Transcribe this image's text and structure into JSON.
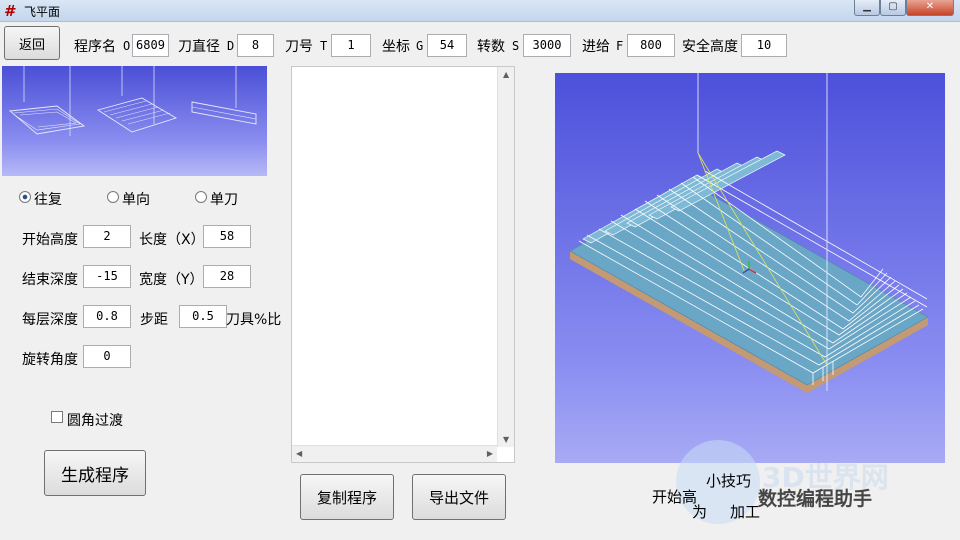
{
  "window": {
    "title": "飞平面",
    "icon_glyph": "#"
  },
  "toolbar": {
    "back_label": "返回",
    "params": [
      {
        "label": "程序名",
        "prefix": "O",
        "value": "6809"
      },
      {
        "label": "刀直径",
        "prefix": "D",
        "value": "8"
      },
      {
        "label": "刀号",
        "prefix": "T",
        "value": "1"
      },
      {
        "label": "坐标",
        "prefix": "G",
        "value": "54"
      },
      {
        "label": "转数",
        "prefix": "S",
        "value": "3000"
      },
      {
        "label": "进给",
        "prefix": "F",
        "value": "800"
      },
      {
        "label": "安全高度",
        "prefix": "",
        "value": "10"
      }
    ]
  },
  "modes": {
    "options": [
      "往复",
      "单向",
      "单刀"
    ],
    "selected": "往复"
  },
  "form": {
    "start_height": {
      "label": "开始高度",
      "value": "2"
    },
    "length": {
      "label": "长度（X）",
      "value": "58"
    },
    "end_depth": {
      "label": "结束深度",
      "value": "-15"
    },
    "width": {
      "label": "宽度（Y）",
      "value": "28"
    },
    "layer_depth": {
      "label": "每层深度",
      "value": "0.8"
    },
    "step": {
      "label": "步距",
      "value": "0.5",
      "suffix": "刀具%比"
    },
    "rotation": {
      "label": "旋转角度",
      "value": "0"
    },
    "round_corner": {
      "label": "圆角过渡",
      "checked": false
    }
  },
  "actions": {
    "generate_label": "生成程序",
    "copy_label": "复制程序",
    "export_label": "导出文件"
  },
  "code_output": {
    "text": ""
  },
  "preview": {
    "tip_title": "小技巧",
    "tip_line1": "开始高",
    "tip_line2": "为",
    "tip_line3": "加工"
  },
  "watermark": {
    "text": "数控编程助手",
    "logo_text": "3D世界网"
  },
  "colors": {
    "viewport_top": "#4c50db",
    "stock_top": "#6aa6c6",
    "stock_side": "#c49a74",
    "toolpath": "#ffffff",
    "tool_line": "#d8e060"
  }
}
